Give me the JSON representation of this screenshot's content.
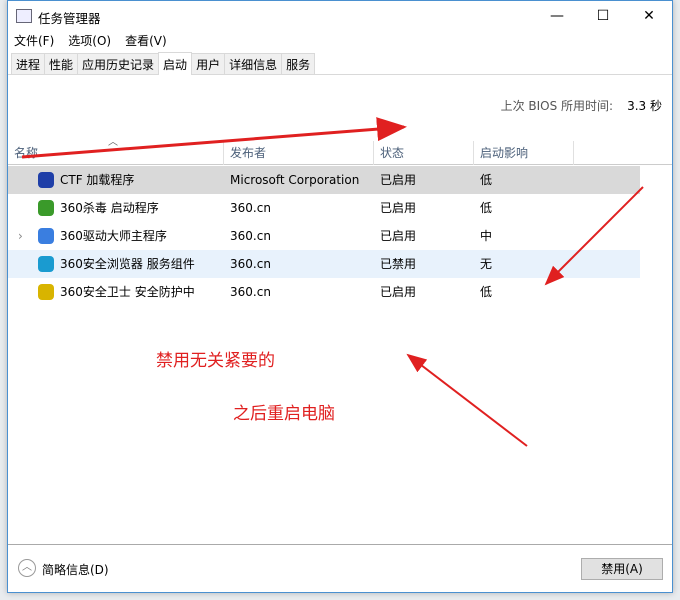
{
  "window": {
    "title": "任务管理器",
    "minimize": "—",
    "maximize": "☐",
    "close": "✕"
  },
  "menu": [
    "文件(F)",
    "选项(O)",
    "查看(V)"
  ],
  "tabs": [
    "进程",
    "性能",
    "应用历史记录",
    "启动",
    "用户",
    "详细信息",
    "服务"
  ],
  "active_tab": "启动",
  "bios": {
    "label": "上次 BIOS 所用时间:",
    "value": "3.3 秒"
  },
  "columns": [
    "名称",
    "发布者",
    "状态",
    "启动影响"
  ],
  "rows": [
    {
      "name": "CTF 加载程序",
      "publisher": "Microsoft Corporation",
      "status": "已启用",
      "impact": "低",
      "icon": "pen-icon",
      "color": "#1f3fa8"
    },
    {
      "name": "360杀毒 启动程序",
      "publisher": "360.cn",
      "status": "已启用",
      "impact": "低",
      "icon": "shield-icon",
      "color": "#3a9a2a"
    },
    {
      "name": "360驱动大师主程序",
      "publisher": "360.cn",
      "status": "已启用",
      "impact": "中",
      "icon": "driver-icon",
      "color": "#3a7ee0"
    },
    {
      "name": "360安全浏览器 服务组件",
      "publisher": "360.cn",
      "status": "已禁用",
      "impact": "无",
      "icon": "browser-icon",
      "color": "#1a9bd0"
    },
    {
      "name": "360安全卫士 安全防护中",
      "publisher": "360.cn",
      "status": "已启用",
      "impact": "低",
      "icon": "guard-icon",
      "color": "#d8b400"
    }
  ],
  "notes": [
    "禁用无关紧要的",
    "之后重启电脑"
  ],
  "footer": {
    "less_details": "简略信息(D)",
    "disable": "禁用(A)"
  }
}
